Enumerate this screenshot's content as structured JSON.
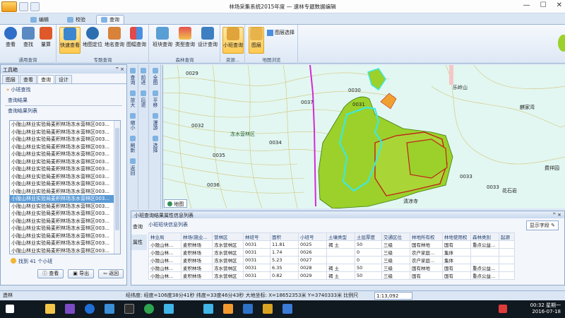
{
  "window": {
    "title": "林场采集系统2015年度 — 速林专题数据编辑",
    "controls": [
      "—",
      "☐",
      "✕"
    ]
  },
  "ribbon_tabs": [
    "编辑",
    "校验",
    "查询"
  ],
  "ribbon": {
    "groups": [
      {
        "label": "通用查询",
        "buttons": [
          "查看",
          "查找",
          "量算"
        ]
      },
      {
        "label": "专题查询",
        "buttons": [
          "快速查看",
          "地图定位",
          "地名查询",
          "图幅查询"
        ]
      },
      {
        "label": "森林查询",
        "buttons": [
          "班块查询",
          "类型查询",
          "设计查询"
        ]
      },
      {
        "label": "资源...",
        "buttons": [
          "小班查询"
        ]
      },
      {
        "label": "地图浏览",
        "buttons": [
          "图层",
          "图层选择"
        ]
      }
    ]
  },
  "toolbox": {
    "title": "工具箱",
    "pin": "ꟸ ×",
    "tabs": [
      "图层",
      "查看",
      "查询",
      "设计"
    ],
    "section": "小班查找",
    "results_label": "查询结果",
    "list_label": "查询结果列表",
    "rows": [
      "小陇山林业实验局麦积林场冻水营林区003...",
      "小陇山林业实验局麦积林场冻水营林区003...",
      "小陇山林业实验局麦积林场冻水营林区003...",
      "小陇山林业实验局麦积林场冻水营林区003...",
      "小陇山林业实验局麦积林场冻水营林区003...",
      "小陇山林业实验局麦积林场冻水营林区003...",
      "小陇山林业实验局麦积林场冻水营林区003...",
      "小陇山林业实验局麦积林场冻水营林区003...",
      "小陇山林业实验局麦积林场冻水营林区003...",
      "小陇山林业实验局麦积林场冻水营林区003...",
      "小陇山林业实验局麦积林场冻水营林区003...",
      "小陇山林业实验局麦积林场冻水营林区003...",
      "小陇山林业实验局麦积林场冻水营林区003...",
      "小陇山林业实验局麦积林场冻水营林区003...",
      "小陇山林业实验局麦积林场冻水营林区003...",
      "小陇山林业实验局麦积林场冻水营林区003...",
      "小陇山林业实验局麦积林场冻水营林区003...",
      "小陇山林业实验局麦积林场冻水营林区003..."
    ],
    "selected_index": 10,
    "found_text": "找到 41 个小班",
    "buttons": [
      "查看",
      "导出",
      "返回"
    ]
  },
  "strip_left": [
    "查询",
    "放大",
    "缩小",
    "刷新",
    "返回"
  ],
  "strip_mid": [
    "前进",
    "后退",
    "全图",
    "平移",
    "漫游",
    "选择"
  ],
  "map": {
    "tab": "地图",
    "labels": [
      "0029",
      "0031",
      "0032",
      "0033",
      "0034",
      "0035",
      "0036",
      "0037",
      "0030",
      "冻水营林区",
      "0033",
      "乐岭山",
      "麒家湾",
      "清凉寺",
      "花石岩",
      "费祥园"
    ]
  },
  "attr": {
    "title": "小班查询结果属性信息列表",
    "pin": "ꟸ ×",
    "side_tabs": [
      "查询",
      "属性"
    ],
    "subtitle": "小班班块信息列表",
    "show_fields": "显示字段",
    "columns": [
      "林业局",
      "林场(施业...",
      "营林区",
      "林班号",
      "面积",
      "小班号",
      "土壤类型",
      "土层厚度",
      "交通区位",
      "林地所有权",
      "林地使用权",
      "森林类别",
      "起源"
    ],
    "rows": [
      [
        "小陇山林...",
        "麦积林场",
        "冻水营林区",
        "0031",
        "11.81",
        "0025",
        "褐 土",
        "50",
        "三级",
        "国有林地",
        "国有",
        "重点公益...",
        ""
      ],
      [
        "小陇山林...",
        "麦积林场",
        "冻水营林区",
        "0031",
        "1.74",
        "0026",
        "",
        "0",
        "三级",
        "农户家庭...",
        "集体",
        "",
        ""
      ],
      [
        "小陇山林...",
        "麦积林场",
        "冻水营林区",
        "0031",
        "5.23",
        "0027",
        "",
        "0",
        "三级",
        "农户家庭...",
        "集体",
        "",
        ""
      ],
      [
        "小陇山林...",
        "麦积林场",
        "冻水营林区",
        "0031",
        "6.35",
        "0028",
        "褐 土",
        "50",
        "三级",
        "国有林地",
        "国有",
        "重点公益...",
        ""
      ],
      [
        "小陇山林...",
        "麦积林场",
        "冻水营林区",
        "0031",
        "0.82",
        "0029",
        "褐 土",
        "50",
        "三级",
        "国有",
        "国有",
        "重点公益...",
        ""
      ]
    ]
  },
  "status": {
    "left": "造林",
    "coords": "经纬度: 经度=106度38分41秒 纬度=33度46分43秒  大地坐标: X=18652353米 Y=3740333米  比例尺",
    "scale": "1:13,092"
  },
  "clock": {
    "time": "00:32 星期一",
    "date": "2016-07-18"
  },
  "colors": {
    "forest_green": "#9bd12a",
    "parcel_red": "#c0241b",
    "cyan_highlight": "#3ee8e0",
    "boundary_magenta": "#d629d6",
    "contour_yellow": "#d4c27a"
  }
}
